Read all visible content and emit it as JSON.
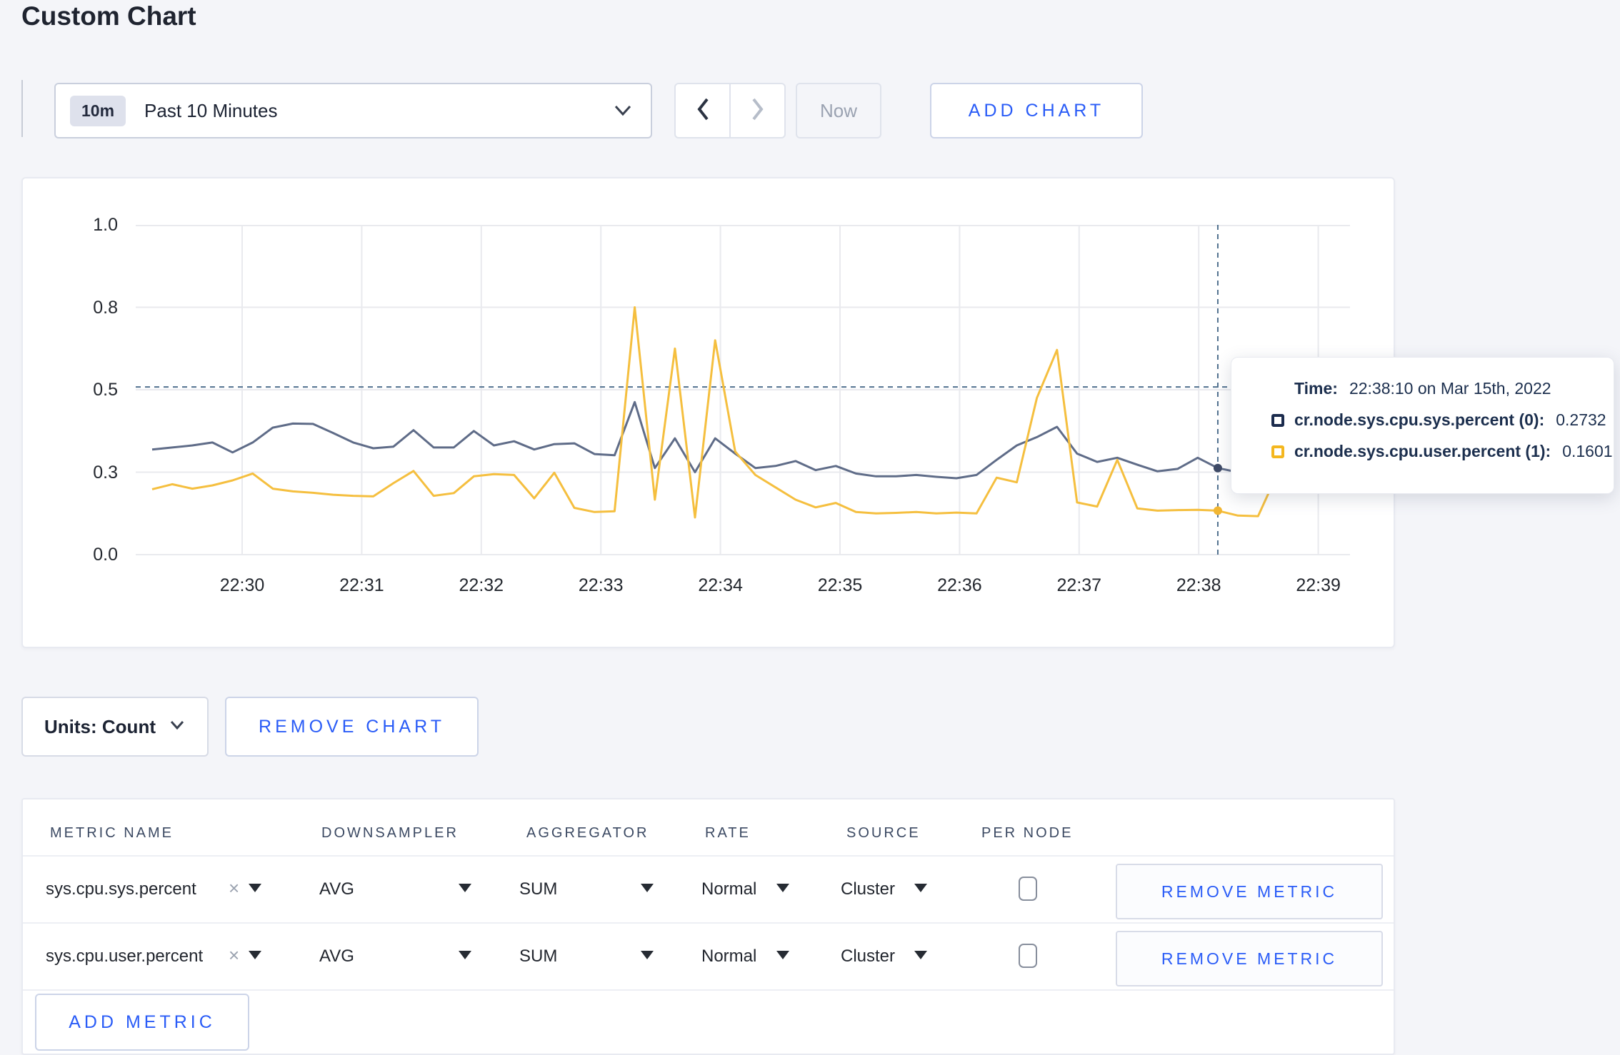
{
  "page": {
    "title": "Custom Chart"
  },
  "toolbar": {
    "range_badge": "10m",
    "range_label": "Past 10 Minutes",
    "now_label": "Now",
    "add_chart_label": "ADD CHART"
  },
  "chart_data": {
    "type": "line",
    "title": "",
    "x_start": "22:29:20",
    "x_interval_seconds": 10,
    "x_ticks": [
      "22:30",
      "22:31",
      "22:32",
      "22:33",
      "22:34",
      "22:35",
      "22:36",
      "22:37",
      "22:38",
      "22:39"
    ],
    "y_axis": {
      "range": [
        0,
        1.0
      ],
      "tick_values": [
        0,
        0.3,
        0.5,
        0.8,
        1.0
      ],
      "tick_labels": [
        "0.0",
        "0.3",
        "0.5",
        "0.8",
        "1.0"
      ]
    },
    "grid": true,
    "legend_position": "tooltip",
    "series": [
      {
        "name": "cr.node.sys.cpu.sys.percent (0)",
        "color": "#5f6c88",
        "values": [
          0.355,
          0.36,
          0.365,
          0.372,
          0.348,
          0.372,
          0.408,
          0.418,
          0.417,
          0.395,
          0.372,
          0.358,
          0.362,
          0.402,
          0.36,
          0.36,
          0.4,
          0.365,
          0.375,
          0.355,
          0.368,
          0.37,
          0.344,
          0.341,
          0.47,
          0.31,
          0.382,
          0.3,
          0.382,
          0.345,
          0.31,
          0.315,
          0.327,
          0.305,
          0.315,
          0.295,
          0.285,
          0.285,
          0.29,
          0.283,
          0.278,
          0.29,
          0.33,
          0.365,
          0.385,
          0.41,
          0.345,
          0.325,
          0.335,
          0.318,
          0.302,
          0.308,
          0.335,
          0.31,
          0.3,
          0.295,
          0.3,
          0.308,
          0.315,
          0.3
        ]
      },
      {
        "name": "cr.node.sys.cpu.user.percent (1)",
        "color": "#f5bf3f",
        "values": [
          0.238,
          0.256,
          0.24,
          0.252,
          0.27,
          0.295,
          0.24,
          0.23,
          0.225,
          0.218,
          0.214,
          0.212,
          0.26,
          0.303,
          0.214,
          0.224,
          0.285,
          0.293,
          0.29,
          0.205,
          0.298,
          0.17,
          0.155,
          0.158,
          0.8,
          0.2,
          0.65,
          0.135,
          0.68,
          0.35,
          0.29,
          0.245,
          0.2,
          0.172,
          0.188,
          0.155,
          0.15,
          0.152,
          0.155,
          0.15,
          0.153,
          0.15,
          0.28,
          0.263,
          0.48,
          0.645,
          0.19,
          0.175,
          0.33,
          0.168,
          0.16,
          0.162,
          0.163,
          0.16,
          0.142,
          0.14,
          0.3,
          0.293,
          0.305,
          0.258
        ]
      }
    ],
    "crosshair": {
      "time": "22:38:10",
      "x_index": 53,
      "hline_value": 0.51,
      "point_values": {
        "sys": 0.31,
        "user": 0.16
      }
    }
  },
  "tooltip": {
    "time_label": "Time:",
    "time_value": "22:38:10 on Mar 15th, 2022",
    "rows": [
      {
        "label": "cr.node.sys.cpu.sys.percent (0):",
        "value": "0.2732",
        "color": "#1b2b4d"
      },
      {
        "label": "cr.node.sys.cpu.user.percent (1):",
        "value": "0.1601",
        "color": "#f4b71f"
      }
    ]
  },
  "chart_controls": {
    "units_label": "Units: Count",
    "remove_chart_label": "REMOVE CHART"
  },
  "metrics": {
    "headers": [
      "METRIC NAME",
      "DOWNSAMPLER",
      "AGGREGATOR",
      "RATE",
      "SOURCE",
      "PER NODE"
    ],
    "rows": [
      {
        "name": "sys.cpu.sys.percent",
        "downsampler": "AVG",
        "aggregator": "SUM",
        "rate": "Normal",
        "source": "Cluster",
        "per_node": false
      },
      {
        "name": "sys.cpu.user.percent",
        "downsampler": "AVG",
        "aggregator": "SUM",
        "rate": "Normal",
        "source": "Cluster",
        "per_node": false
      }
    ],
    "remove_metric_label": "REMOVE METRIC",
    "add_metric_label": "ADD METRIC"
  },
  "colors": {
    "accent_blue": "#2a5cf7",
    "series_sys": "#5f6c88",
    "series_user": "#f5bf3f",
    "crosshair": "#51718f",
    "gridline": "#e9eaee",
    "page_bg": "#f4f5f9"
  }
}
